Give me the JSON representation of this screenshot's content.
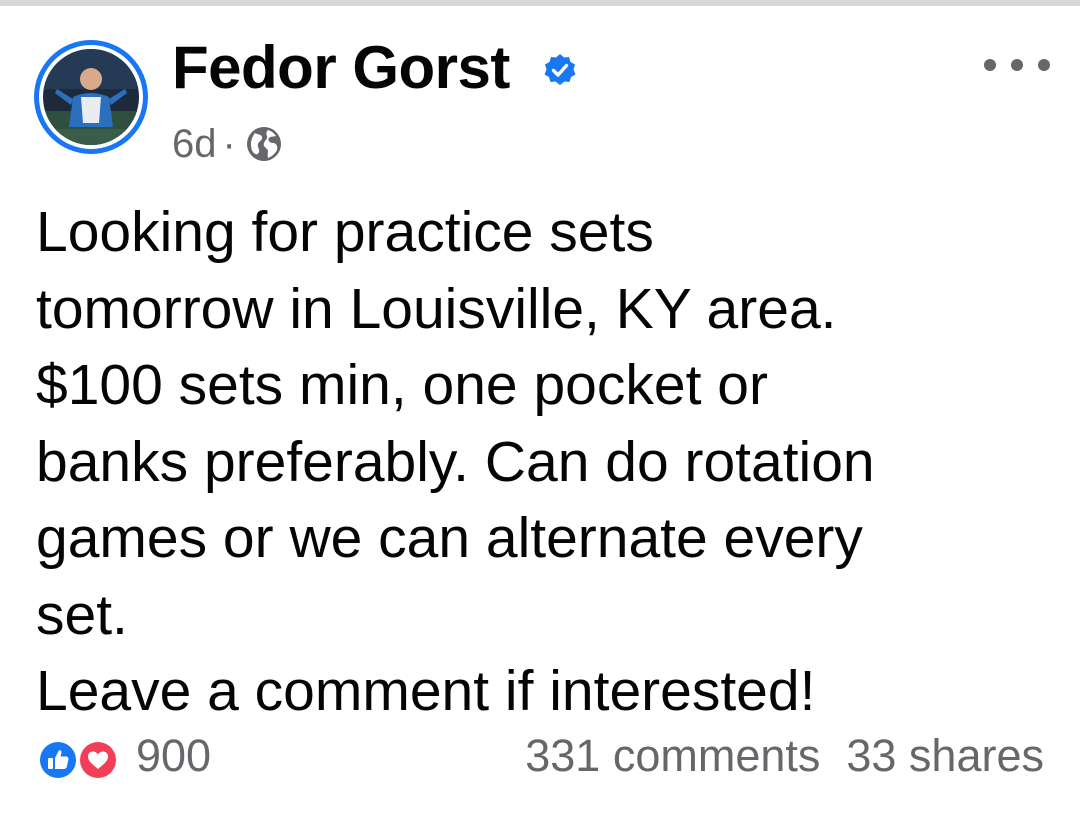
{
  "post": {
    "author": {
      "name": "Fedor Gorst",
      "verified": true
    },
    "meta": {
      "time": "6d",
      "separator": "·",
      "audience_icon": "globe-icon"
    },
    "more_icon": "more-horizontal-icon",
    "text_lines": [
      "Looking for practice sets",
      "tomorrow in Louisville, KY area.",
      "$100 sets min, one pocket or",
      "banks preferably. Can do rotation",
      "games or we can alternate every",
      "set.",
      "Leave a comment if interested!"
    ],
    "reactions": {
      "icons": [
        "like-reaction-icon",
        "love-reaction-icon"
      ],
      "count": "900"
    },
    "stats": {
      "comments": "331 comments",
      "shares": "33 shares"
    }
  },
  "colors": {
    "brand_blue": "#1877f2",
    "secondary_text": "#65676b",
    "love_red": "#f33e58"
  }
}
